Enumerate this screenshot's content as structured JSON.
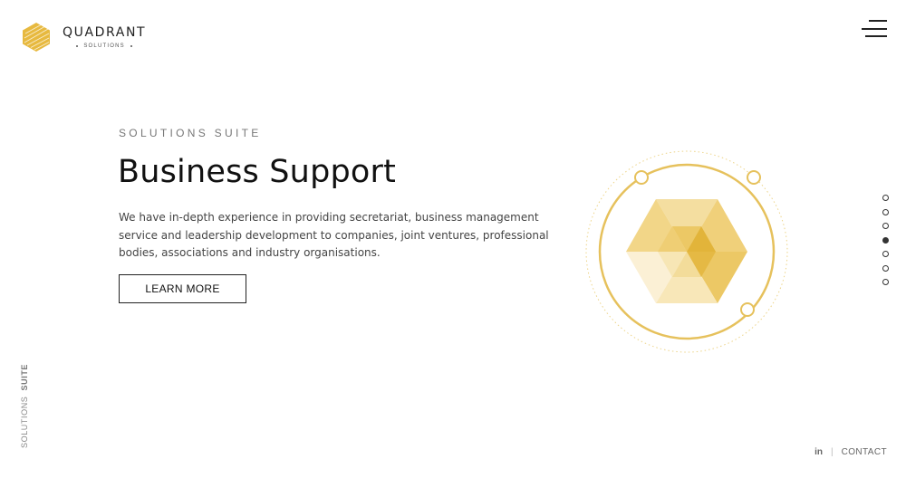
{
  "brand": {
    "name": "QUADRANT",
    "sub": "SOLUTIONS"
  },
  "hero": {
    "eyebrow": "SOLUTIONS SUITE",
    "title": "Business Support",
    "description": "We have in-depth experience in providing secretariat, business management service and leadership development to companies, joint ventures, professional bodies, associations and industry organisations.",
    "cta_label": "LEARN MORE"
  },
  "pagination": {
    "total": 7,
    "active": 4
  },
  "side_label": {
    "light": "SOLUTIONS",
    "bold": "SUITE"
  },
  "footer": {
    "linkedin": "in",
    "separator": "|",
    "contact": "CONTACT"
  },
  "colors": {
    "accent": "#e8c15a",
    "accent_dark": "#e2b43a",
    "text": "#111111"
  },
  "icons": [
    "quadrant-logo-icon",
    "menu-icon",
    "hexagon-cube-icon",
    "linkedin-icon"
  ]
}
